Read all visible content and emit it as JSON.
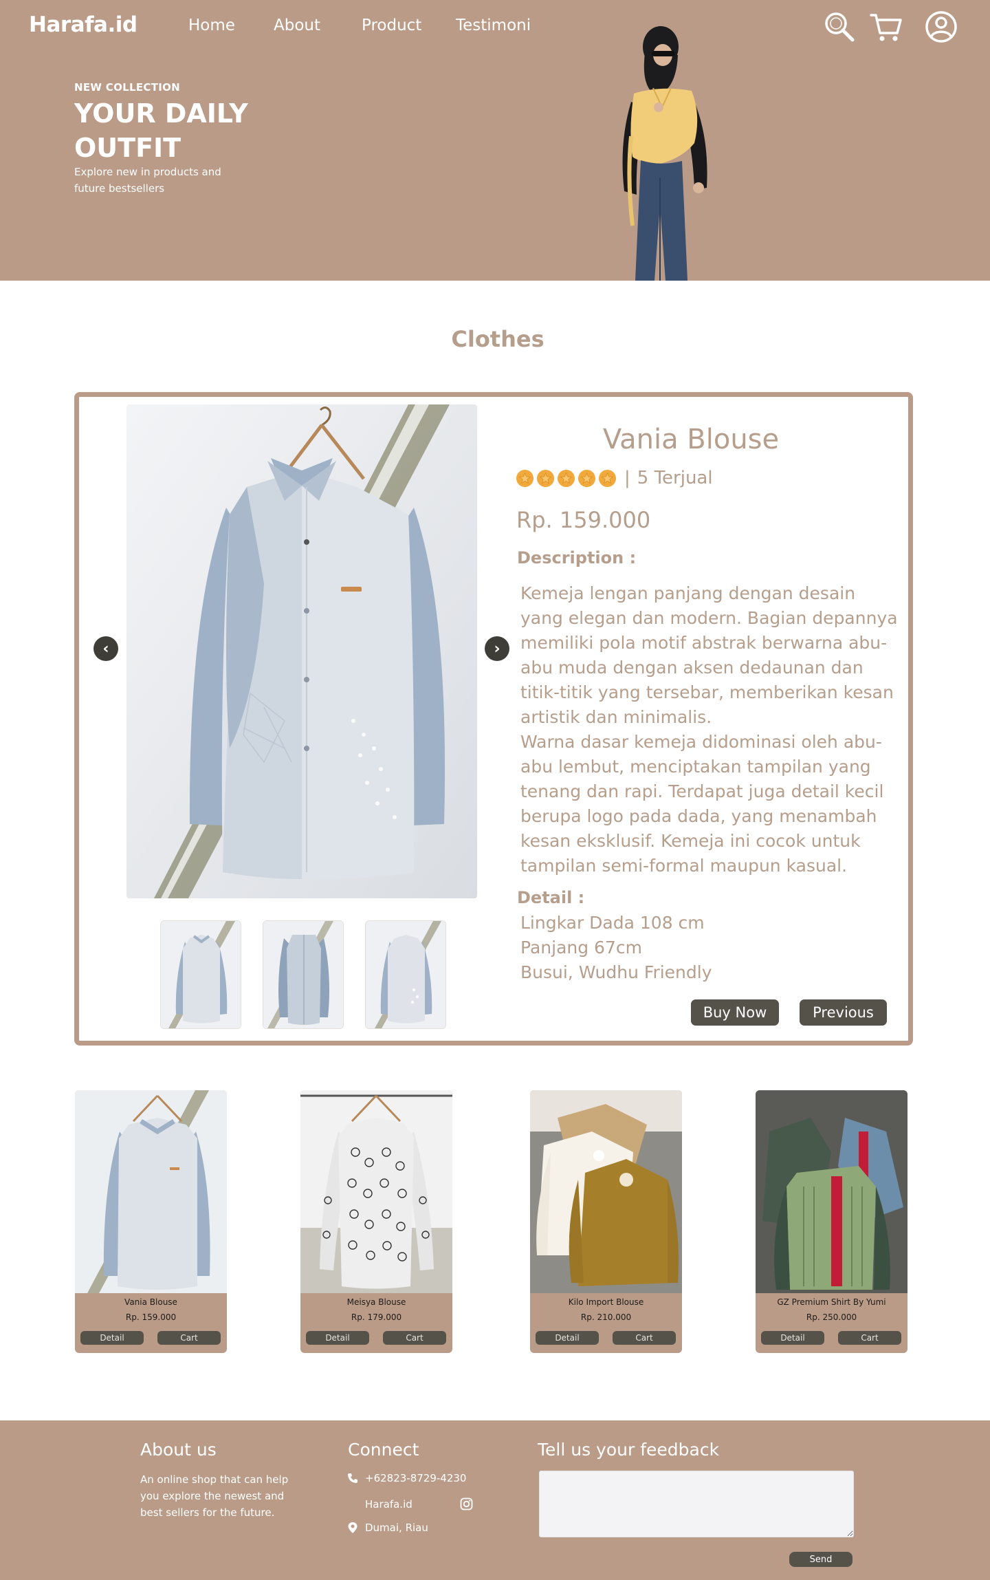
{
  "colors": {
    "brand": "#b99b87",
    "dark_button": "#55524a",
    "text_tan": "#b59e8c",
    "star": "#f2a93b"
  },
  "header": {
    "brand": "Harafa.id",
    "nav": [
      "Home",
      "About",
      "Product",
      "Testimoni"
    ],
    "icons": [
      "search-icon",
      "cart-icon",
      "user-icon"
    ]
  },
  "hero": {
    "kicker": "NEW COLLECTION",
    "title": "YOUR DAILY OUTFIT",
    "subtitle": "Explore new in products and future bestsellers"
  },
  "section_title": "Clothes",
  "product_detail": {
    "name": "Vania Blouse",
    "rating": 5,
    "separator": "|",
    "sold": "5 Terjual",
    "price": "Rp. 159.000",
    "description_label": "Description :",
    "description": [
      "Kemeja lengan panjang dengan desain yang elegan dan modern. Bagian depannya memiliki pola motif abstrak berwarna abu-abu muda dengan aksen dedaunan dan titik-titik yang tersebar, memberikan kesan artistik dan minimalis.",
      "Warna dasar kemeja didominasi oleh abu-abu lembut, menciptakan tampilan yang tenang dan rapi. Terdapat juga detail kecil berupa logo pada dada, yang menambah kesan eksklusif. Kemeja ini cocok untuk tampilan semi-formal maupun kasual."
    ],
    "detail_label": "Detail :",
    "details": [
      "Lingkar Dada 108 cm",
      "Panjang 67cm",
      "Busui, Wudhu Friendly"
    ],
    "buy_label": "Buy Now",
    "previous_label": "Previous"
  },
  "products": [
    {
      "name": "Vania Blouse",
      "price": "Rp. 159.000",
      "detail_label": "Detail",
      "cart_label": "Cart"
    },
    {
      "name": "Meisya Blouse",
      "price": "Rp. 179.000",
      "detail_label": "Detail",
      "cart_label": "Cart"
    },
    {
      "name": "Kilo Import Blouse",
      "price": "Rp. 210.000",
      "detail_label": "Detail",
      "cart_label": "Cart"
    },
    {
      "name": "GZ Premium Shirt By Yumi",
      "price": "Rp. 250.000",
      "detail_label": "Detail",
      "cart_label": "Cart"
    }
  ],
  "footer": {
    "about_title": "About us",
    "about_text": "An online shop that can help you explore the newest and best sellers for the future.",
    "connect_title": "Connect",
    "phone": "+62823-8729-4230",
    "instagram": "Harafa.id",
    "location": "Dumai, Riau",
    "feedback_title": "Tell us your feedback",
    "send_label": "Send"
  }
}
